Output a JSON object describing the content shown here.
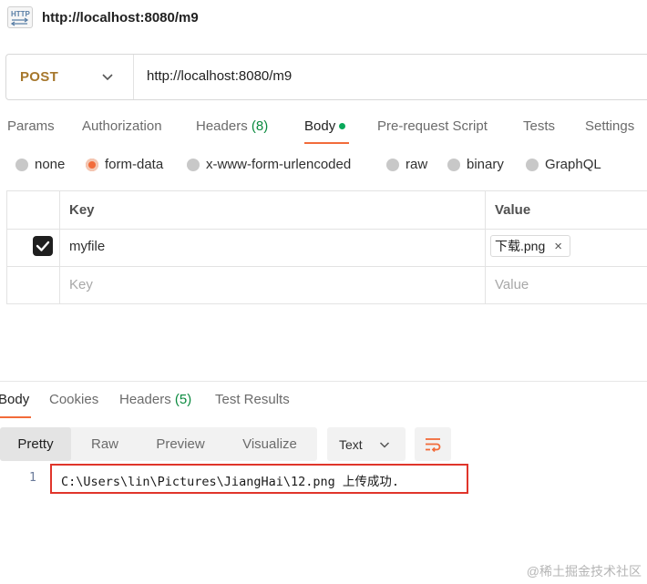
{
  "title_bar": {
    "icon": "http-icon",
    "url": "http://localhost:8080/m9"
  },
  "request": {
    "method": "POST",
    "url": "http://localhost:8080/m9"
  },
  "tabs": [
    {
      "label": "Params"
    },
    {
      "label": "Authorization"
    },
    {
      "label": "Headers",
      "count": "(8)"
    },
    {
      "label": "Body"
    },
    {
      "label": "Pre-request Script"
    },
    {
      "label": "Tests"
    },
    {
      "label": "Settings"
    }
  ],
  "active_tab": "Body",
  "body_types": [
    {
      "label": "none"
    },
    {
      "label": "form-data"
    },
    {
      "label": "x-www-form-urlencoded"
    },
    {
      "label": "raw"
    },
    {
      "label": "binary"
    },
    {
      "label": "GraphQL"
    }
  ],
  "selected_body_type": "form-data",
  "table": {
    "headers": {
      "key": "Key",
      "value": "Value"
    },
    "rows": [
      {
        "checked": true,
        "key": "myfile",
        "file": "下载.png",
        "remove": "×"
      }
    ],
    "placeholder": {
      "key": "Key",
      "value": "Value"
    }
  },
  "response": {
    "tabs": [
      {
        "label": "Body"
      },
      {
        "label": "Cookies"
      },
      {
        "label": "Headers",
        "count": "(5)"
      },
      {
        "label": "Test Results"
      }
    ],
    "views": [
      "Pretty",
      "Raw",
      "Preview",
      "Visualize"
    ],
    "selected_view": "Pretty",
    "format": "Text",
    "lines": [
      {
        "number": "1",
        "text": "C:\\Users\\lin\\Pictures\\JiangHai\\12.png 上传成功."
      }
    ]
  },
  "colors": {
    "accent": "#f26b3a",
    "post_method": "#a6772c",
    "count_green": "#0b8a3f",
    "highlight_red": "#e0352b"
  },
  "watermark": "@稀土掘金技术社区"
}
